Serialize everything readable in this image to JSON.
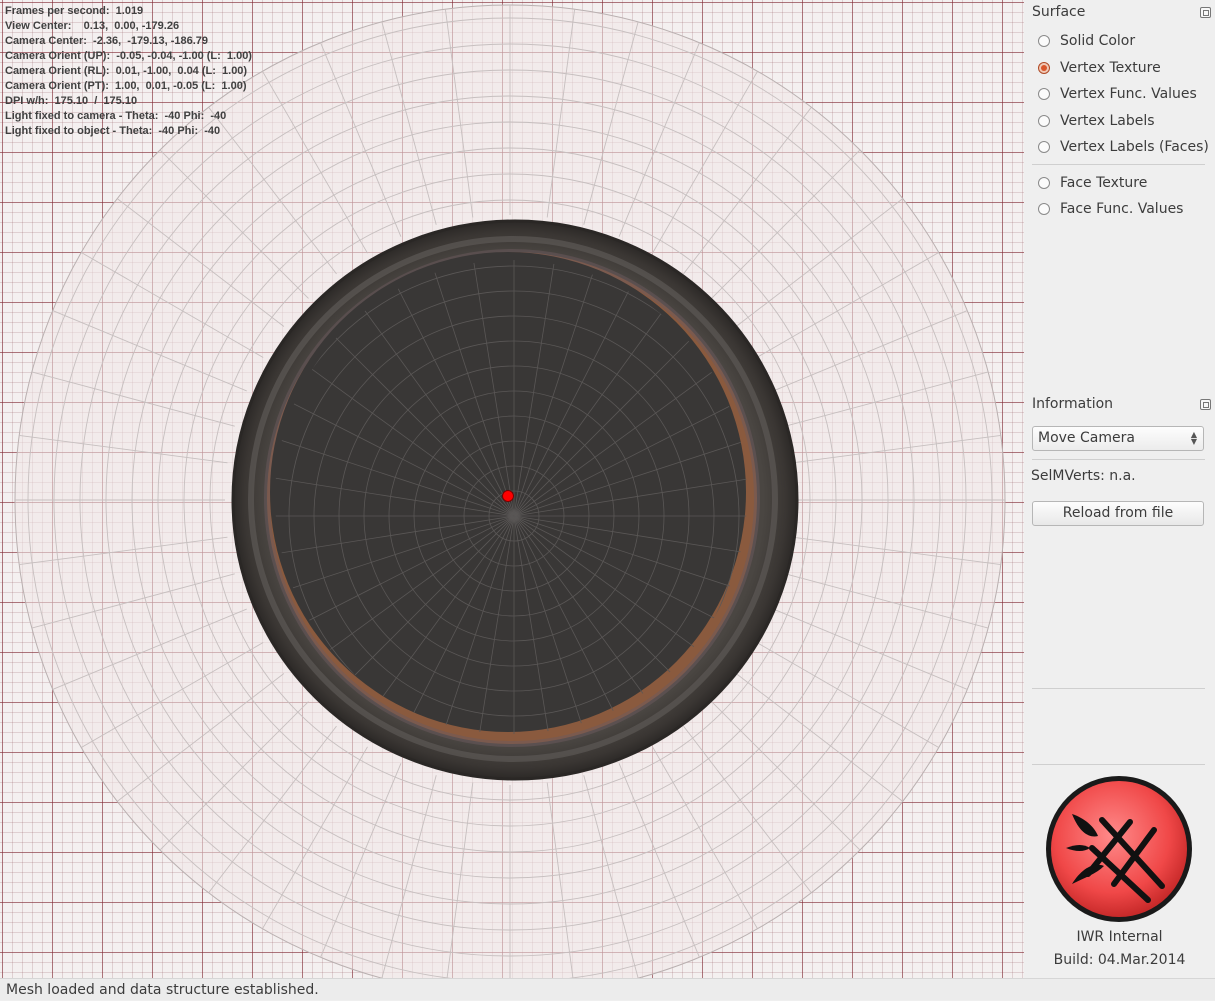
{
  "hud": {
    "lines": [
      "Frames per second:  1.019",
      "View Center:    0.13,  0.00, -179.26",
      "Camera Center:  -2.36,  -179.13, -186.79",
      "Camera Orient (UP):  -0.05, -0.04, -1.00 (L:  1.00)",
      "Camera Orient (RL):  0.01, -1.00,  0.04 (L:  1.00)",
      "Camera Orient (PT):  1.00,  0.01, -0.05 (L:  1.00)",
      "DPI w/h:  175.10  /  175.10",
      "Light fixed to camera - Theta:  -40 Phi:  -40",
      "Light fixed to object - Theta:  -40 Phi:  -40"
    ]
  },
  "surface": {
    "title": "Surface",
    "options": [
      {
        "label": "Solid Color",
        "selected": false
      },
      {
        "label": "Vertex Texture",
        "selected": true
      },
      {
        "label": "Vertex Func. Values",
        "selected": false
      },
      {
        "label": "Vertex Labels",
        "selected": false
      },
      {
        "label": "Vertex Labels (Faces)",
        "selected": false
      },
      {
        "label": "Face Texture",
        "selected": false
      },
      {
        "label": "Face Func. Values",
        "selected": false
      }
    ]
  },
  "information": {
    "title": "Information",
    "mode_select": "Move Camera",
    "selmverts": "SelMVerts: n.a.",
    "reload_label": "Reload from file"
  },
  "about": {
    "line1": "IWR Internal",
    "line2": "Build: 04.Mar.2014"
  },
  "status": "Mesh loaded and data structure established.",
  "colors": {
    "accent": "#d9562b",
    "logo_red": "#f05050",
    "marker": "#ff0000"
  }
}
